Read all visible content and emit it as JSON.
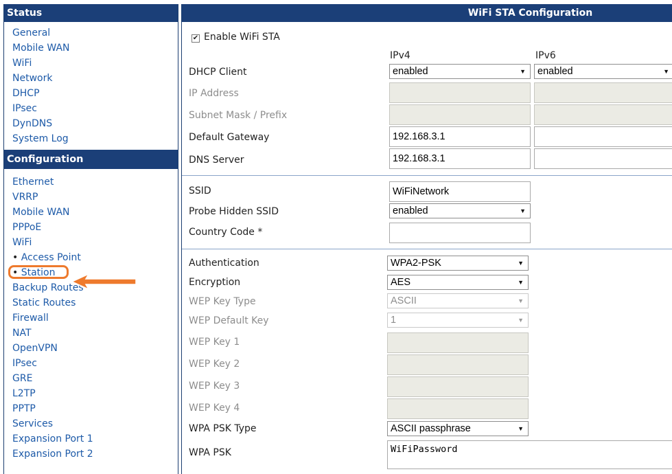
{
  "sidebar": {
    "status_header": "Status",
    "status_items": [
      "General",
      "Mobile WAN",
      "WiFi",
      "Network",
      "DHCP",
      "IPsec",
      "DynDNS",
      "System Log"
    ],
    "config_header": "Configuration",
    "config_items": [
      {
        "label": "Ethernet"
      },
      {
        "label": "VRRP"
      },
      {
        "label": "Mobile WAN"
      },
      {
        "label": "PPPoE"
      },
      {
        "label": "WiFi"
      },
      {
        "label": "Access Point",
        "bullet": "• "
      },
      {
        "label": "Station",
        "bullet": "• "
      },
      {
        "label": "Backup Routes"
      },
      {
        "label": "Static Routes"
      },
      {
        "label": "Firewall"
      },
      {
        "label": "NAT"
      },
      {
        "label": "OpenVPN"
      },
      {
        "label": "IPsec"
      },
      {
        "label": "GRE"
      },
      {
        "label": "L2TP"
      },
      {
        "label": "PPTP"
      },
      {
        "label": "Services"
      },
      {
        "label": "Expansion Port 1"
      },
      {
        "label": "Expansion Port 2"
      }
    ]
  },
  "main": {
    "title": "WiFi STA Configuration",
    "enable_label": "Enable WiFi STA",
    "enable_checked": true,
    "col_ipv4": "IPv4",
    "col_ipv6": "IPv6",
    "dhcp_label": "DHCP Client",
    "dhcp_ipv4": "enabled",
    "dhcp_ipv6": "enabled",
    "ip_address_label": "IP Address",
    "subnet_label": "Subnet Mask / Prefix",
    "gateway_label": "Default Gateway",
    "gateway_ipv4": "192.168.3.1",
    "gateway_ipv6": "",
    "dns_label": "DNS Server",
    "dns_ipv4": "192.168.3.1",
    "dns_ipv6": "",
    "ssid_label": "SSID",
    "ssid_value": "WiFiNetwork",
    "probe_label": "Probe Hidden SSID",
    "probe_value": "enabled",
    "country_label": "Country Code *",
    "country_value": "",
    "auth_label": "Authentication",
    "auth_value": "WPA2-PSK",
    "enc_label": "Encryption",
    "enc_value": "AES",
    "wep_type_label": "WEP Key Type",
    "wep_type_value": "ASCII",
    "wep_default_label": "WEP Default Key",
    "wep_default_value": "1",
    "wep_key1_label": "WEP Key 1",
    "wep_key2_label": "WEP Key 2",
    "wep_key3_label": "WEP Key 3",
    "wep_key4_label": "WEP Key 4",
    "psk_type_label": "WPA PSK Type",
    "psk_type_value": "ASCII passphrase",
    "psk_label": "WPA PSK",
    "psk_value": "WiFiPassword"
  },
  "colors": {
    "header_bg": "#1b3f78",
    "link": "#1d5aa8",
    "highlight": "#ee7a2d"
  }
}
